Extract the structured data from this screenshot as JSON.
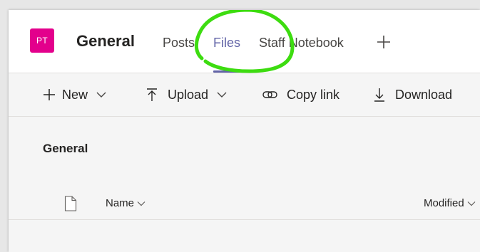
{
  "colors": {
    "avatar_bg": "#e3008c",
    "accent": "#6264a7",
    "annotation": "#3ddc10"
  },
  "channel": {
    "avatar_initials": "PT",
    "title": "General"
  },
  "tabs": [
    {
      "label": "Posts",
      "active": false
    },
    {
      "label": "Files",
      "active": true
    },
    {
      "label": "Staff Notebook",
      "active": false
    }
  ],
  "icons": {
    "add_tab": "plus-icon",
    "new": "plus-icon",
    "upload": "upload-arrow-icon",
    "copy_link": "link-icon",
    "download": "download-arrow-icon",
    "document": "document-icon",
    "chevron": "chevron-down-icon"
  },
  "toolbar": {
    "new_label": "New",
    "upload_label": "Upload",
    "copy_link_label": "Copy link",
    "download_label": "Download"
  },
  "breadcrumb": {
    "current": "General"
  },
  "file_list": {
    "columns": [
      "Name",
      "Modified"
    ]
  }
}
